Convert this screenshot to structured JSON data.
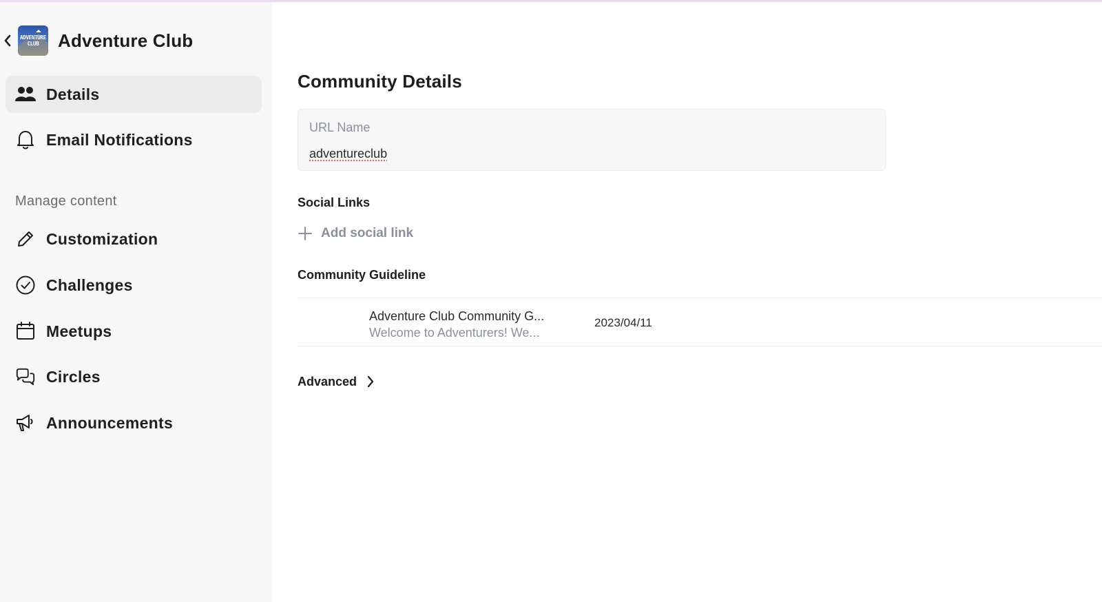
{
  "club": {
    "name": "Adventure Club",
    "logo_text": "ADVENTURE CLUB"
  },
  "sidebar": {
    "items": [
      {
        "label": "Details",
        "icon": "people-icon",
        "active": true
      },
      {
        "label": "Email Notifications",
        "icon": "bell-icon"
      }
    ],
    "section_label": "Manage content",
    "content_items": [
      {
        "label": "Customization",
        "icon": "pencil-icon"
      },
      {
        "label": "Challenges",
        "icon": "check-circle-icon"
      },
      {
        "label": "Meetups",
        "icon": "calendar-icon"
      },
      {
        "label": "Circles",
        "icon": "chat-bubbles-icon"
      },
      {
        "label": "Announcements",
        "icon": "megaphone-icon"
      }
    ]
  },
  "main": {
    "title": "Community Details",
    "url_field": {
      "label": "URL Name",
      "value": "adventureclub"
    },
    "social": {
      "title": "Social Links",
      "add_label": "Add social link"
    },
    "guideline": {
      "title": "Community Guideline",
      "rows": [
        {
          "name": "Adventure Club Community G...",
          "description": "Welcome to Adventurers! We...",
          "date": "2023/04/11"
        }
      ]
    },
    "advanced_label": "Advanced"
  },
  "colors": {
    "sidebar_bg": "#f7f7f7",
    "active_item_bg": "#ebebeb",
    "muted_text": "#8a8fa0",
    "top_accent": "#e8dcef"
  }
}
